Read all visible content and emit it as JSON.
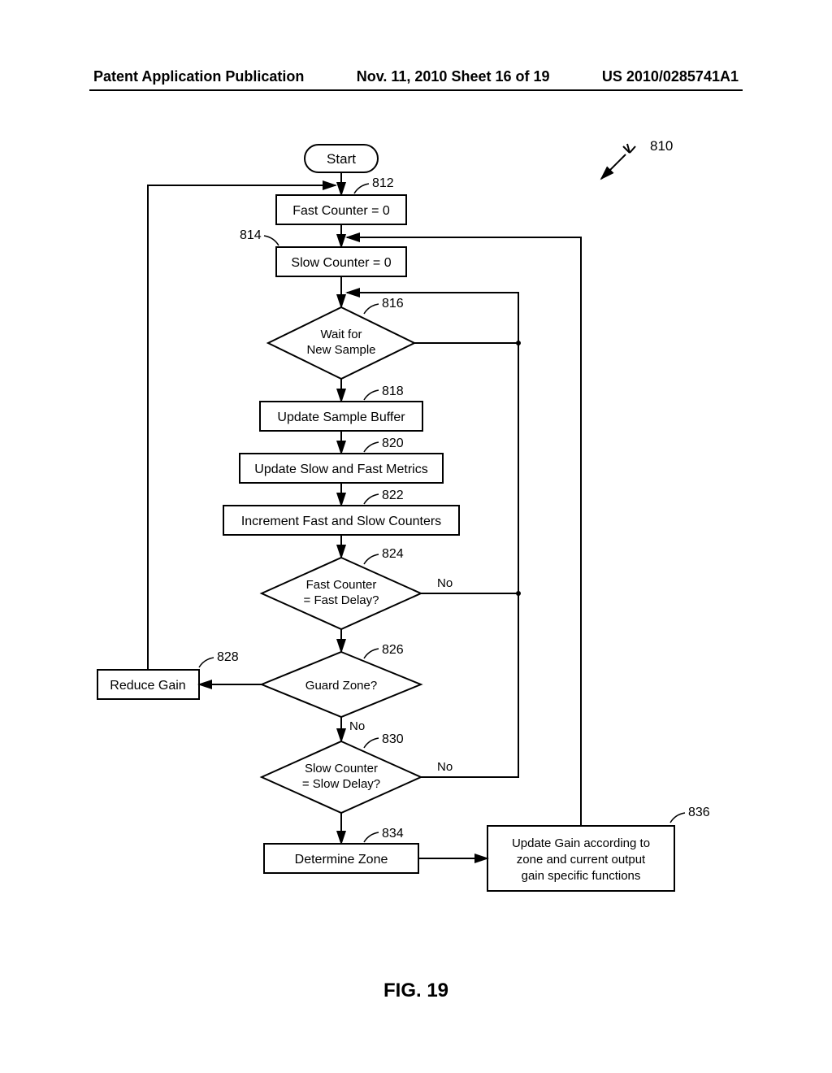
{
  "header": {
    "left": "Patent Application Publication",
    "center": "Nov. 11, 2010  Sheet 16 of 19",
    "right": "US 2010/0285741A1"
  },
  "figure_caption": "FIG. 19",
  "refnum": {
    "r810": "810",
    "r812": "812",
    "r814": "814",
    "r816": "816",
    "r818": "818",
    "r820": "820",
    "r822": "822",
    "r824": "824",
    "r826": "826",
    "r828": "828",
    "r830": "830",
    "r834": "834",
    "r836": "836"
  },
  "nodes": {
    "start": "Start",
    "n812": "Fast Counter = 0",
    "n814": "Slow Counter = 0",
    "n816a": "Wait for",
    "n816b": "New Sample",
    "n818": "Update Sample Buffer",
    "n820": "Update Slow and Fast Metrics",
    "n822": "Increment Fast and Slow Counters",
    "n824a": "Fast Counter",
    "n824b": "= Fast Delay?",
    "n826": "Guard Zone?",
    "n828": "Reduce Gain",
    "n830a": "Slow Counter",
    "n830b": "= Slow Delay?",
    "n834": "Determine Zone",
    "n836a": "Update Gain according to",
    "n836b": "zone and current output",
    "n836c": "gain specific functions"
  },
  "labels": {
    "no824": "No",
    "no826": "No",
    "no830": "No"
  }
}
